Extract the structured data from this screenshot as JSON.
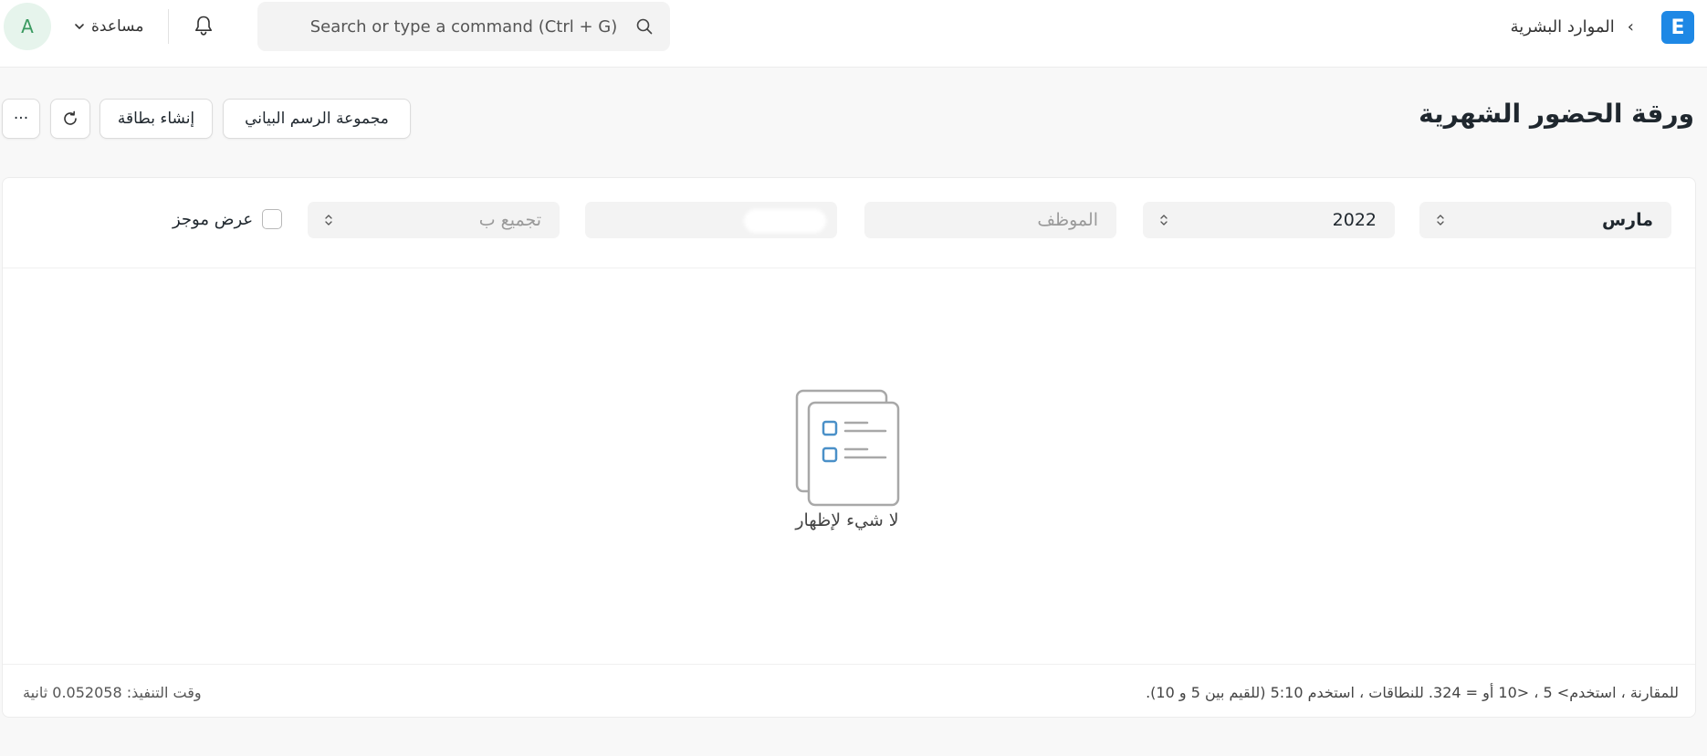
{
  "navbar": {
    "avatar_letter": "A",
    "help_label": "مساعدة",
    "search_placeholder": "Search or type a command (Ctrl + G)",
    "breadcrumb_separator": "›",
    "breadcrumb_module": "الموارد البشرية",
    "logo_letter": "E"
  },
  "page": {
    "title": "ورقة الحضور الشهرية",
    "buttons": {
      "more": "···",
      "create_card": "إنشاء بطاقة",
      "chart_group": "مجموعة الرسم البياني"
    }
  },
  "filters": {
    "month": "مارس",
    "year": "2022",
    "employee_placeholder": "الموظف",
    "group_by_placeholder": "تجميع ب",
    "summary_label": "عرض موجز"
  },
  "empty_state": {
    "text": "لا شيء لإظهار"
  },
  "footer": {
    "hint": "للمقارنة ، استخدم> 5 ، <10 أو = 324. للنطاقات ، استخدم 5:10 (للقيم بين 5 و 10).",
    "execution_time": "وقت التنفيذ: 0.052058 ثانية"
  },
  "colors": {
    "brand": "#1e88e5",
    "avatar_bg": "#e6f4ec",
    "avatar_text": "#3a9a60",
    "empty_icon_accent": "#4a90c8"
  },
  "icons": [
    "chevron-down-icon",
    "bell-icon",
    "search-icon",
    "refresh-icon",
    "select-chevron-icon",
    "empty-list-icon"
  ]
}
